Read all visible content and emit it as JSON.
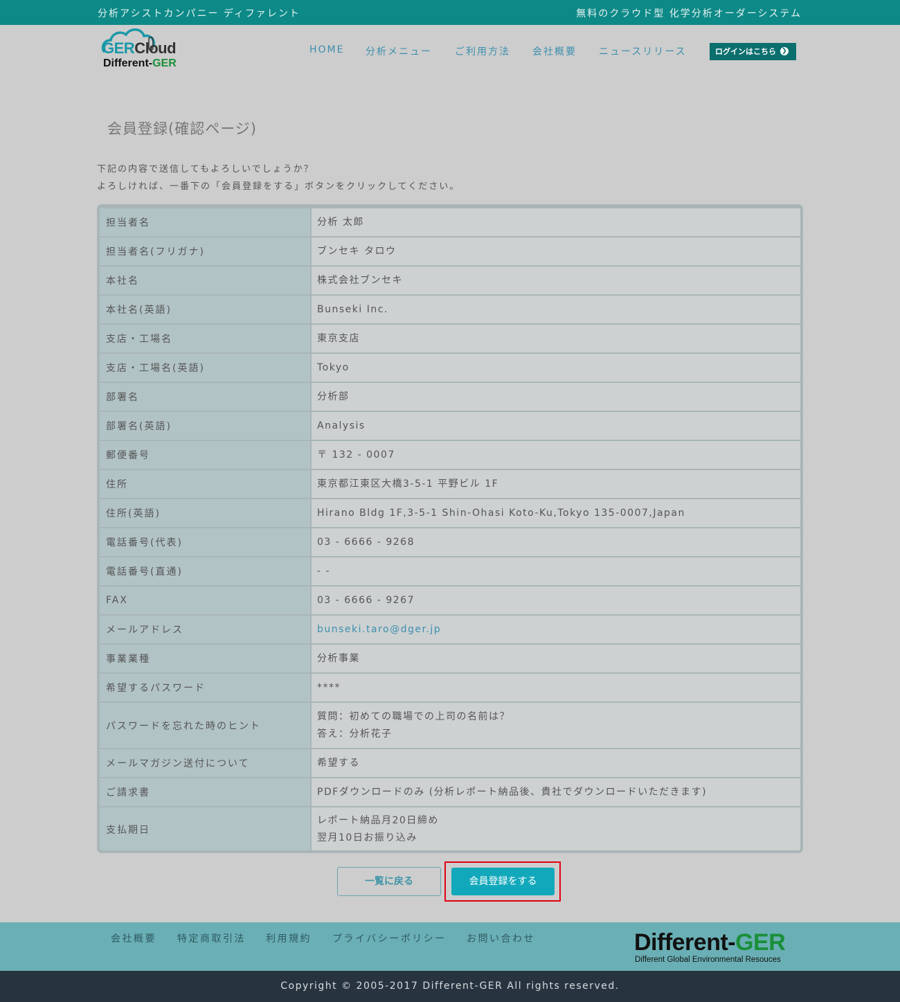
{
  "topbar": {
    "left": "分析アシストカンパニー ディファレント",
    "right": "無料のクラウド型 化学分析オーダーシステム"
  },
  "logo": {
    "part1_brand": "GER",
    "part1_rest": "Cloud",
    "part2_brand": "Different-",
    "part2_rest": "GER"
  },
  "nav": {
    "items": [
      "HOME",
      "分析メニュー",
      "ご利用方法",
      "会社概要",
      "ニュースリリース"
    ],
    "login": "ログインはこちら",
    "login_arrow": "❯"
  },
  "page": {
    "title": "会員登録(確認ページ)",
    "intro_line1": "下記の内容で送信してもよろしいでしょうか？",
    "intro_line2": "よろしければ、一番下の「会員登録をする」ボタンをクリックしてください。"
  },
  "rows": [
    {
      "label": "担当者名",
      "value": "分析 太郎"
    },
    {
      "label": "担当者名(フリガナ)",
      "value": "ブンセキ タロウ"
    },
    {
      "label": "本社名",
      "value": "株式会社ブンセキ"
    },
    {
      "label": "本社名(英語)",
      "value": "Bunseki Inc."
    },
    {
      "label": "支店・工場名",
      "value": "東京支店"
    },
    {
      "label": "支店・工場名(英語)",
      "value": "Tokyo"
    },
    {
      "label": "部署名",
      "value": "分析部"
    },
    {
      "label": "部署名(英語)",
      "value": "Analysis"
    },
    {
      "label": "郵便番号",
      "value": "〒 132 - 0007"
    },
    {
      "label": "住所",
      "value": "東京都江東区大橋3-5-1 平野ビル 1F"
    },
    {
      "label": "住所(英語)",
      "value": "Hirano Bldg 1F,3-5-1 Shin-Ohasi Koto-Ku,Tokyo 135-0007,Japan"
    },
    {
      "label": "電話番号(代表)",
      "value": "03 - 6666 - 9268"
    },
    {
      "label": "電話番号(直通)",
      "value": "- -"
    },
    {
      "label": "FAX",
      "value": "03 - 6666 - 9267"
    },
    {
      "label": "メールアドレス",
      "value": "bunseki.taro@dger.jp"
    },
    {
      "label": "事業業種",
      "value": "分析事業"
    },
    {
      "label": "希望するパスワード",
      "value": "****"
    },
    {
      "label": "パスワードを忘れた時のヒント",
      "value": "質問：初めての職場での上司の名前は？",
      "value2": "答え：分析花子"
    },
    {
      "label": "メールマガジン送付について",
      "value": "希望する"
    },
    {
      "label": "ご請求書",
      "value": "PDFダウンロードのみ (分析レポート納品後、貴社でダウンロードいただきます)"
    },
    {
      "label": "支払期日",
      "value": "レポート納品月20日締め",
      "value2": "翌月10日お振り込み"
    }
  ],
  "buttons": {
    "back": "一覧に戻る",
    "submit": "会員登録をする"
  },
  "footer": {
    "links": [
      "会社概要",
      "特定商取引法",
      "利用規約",
      "プライバシーポリシー",
      "お問い合わせ"
    ],
    "logo_main": "Different-",
    "logo_accent": "GER",
    "logo_sub": "Different Global Environmental Resouces",
    "copyright": "Copyright © 2005-2017 Different-GER All rights reserved."
  },
  "colors": {
    "topbar": "#0d8a87",
    "nav_link": "#3d8fae",
    "login_button": "#0b6f6e",
    "submit_button": "#12a8bb",
    "highlight_frame": "#e00012",
    "footer": "#6aafb5",
    "copyright_bar": "#273440"
  }
}
